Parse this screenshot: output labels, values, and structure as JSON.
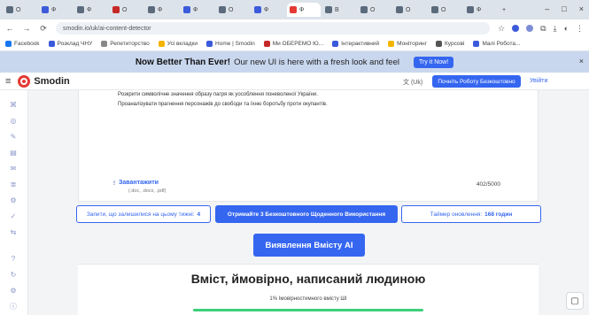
{
  "browser": {
    "tabs": [
      "О",
      "Ф",
      "Ф",
      "О",
      "Ф",
      "Ф",
      "О",
      "Ф",
      "Ф",
      "В",
      "О",
      "О",
      "О",
      "Ф",
      "О"
    ],
    "new_tab": "+",
    "window_controls": [
      "–",
      "□",
      "×"
    ],
    "url": "smodin.io/uk/ai-content-detector",
    "bookmarks": [
      "Facebook",
      "Розклад ЧНУ",
      "Репетиторство",
      "Усі вкладки",
      "Home | Smodin",
      "Ми ОБЕРЕМО Ю...",
      "Інтерактивний",
      "Моніторинг",
      "Курсові",
      "Малі Робота..."
    ]
  },
  "banner": {
    "headline": "Now Better Than Ever!",
    "subtext": "Our new UI is here with a fresh look and feel",
    "cta": "Try it Now!",
    "close": "×"
  },
  "header": {
    "brand": "Smodin",
    "language": "文 (Uk)",
    "primary_button": "Почніть Роботу Безкоштовно",
    "login": "Увійти"
  },
  "editor": {
    "line1": "Розкрити символічне значення образу пагря як уособлення поневоленої України.",
    "line2": "Проаналізувати прагнення персонажів до свободи та їхню боротьбу проти окупантів.",
    "upload_label": "Завантажити",
    "formats": "(.doc, .docx, .pdf)",
    "counter": "402/5000"
  },
  "info_buttons": {
    "left_label": "Запити, що залишилися на цьому тижні:",
    "left_value": "4",
    "middle": "Отримайте 3 Безкоштовного Щоденного Використання",
    "right_label": "Таймер оновлення:",
    "right_value": "168 годин"
  },
  "detect_button": "Виявлення Вмісту AI",
  "result": {
    "title": "Вміст, ймовірно, написаний людиною",
    "subtitle": "1% Імовірностимного вмісту ШІ"
  },
  "colors": {
    "accent": "#3566f0",
    "banner": "#c9d7ee",
    "brand_red": "#e53935",
    "success": "#3ccf7a"
  }
}
